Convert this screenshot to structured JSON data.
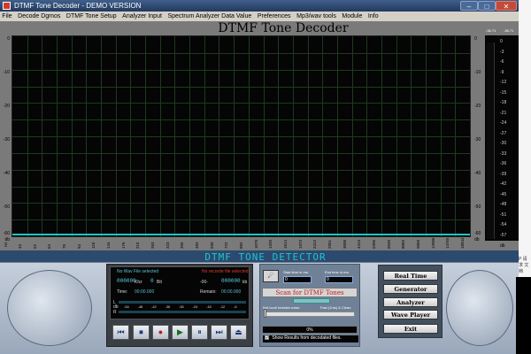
{
  "window": {
    "title": "DTMF Tone Decoder - DEMO VERSION",
    "min_glyph": "–",
    "max_glyph": "□",
    "close_glyph": "✕"
  },
  "menu": [
    "File",
    "Decode Dgmos",
    "DTMF Tone Setup",
    "Analyzer Input",
    "Spectrum Analyzer Data Value",
    "Preferences",
    "Mp3/wav tools",
    "Module",
    "Info"
  ],
  "plot": {
    "title": "DTMF Tone Decoder",
    "y_left_labels": [
      "0",
      "-10",
      "-20",
      "-30",
      "-40",
      "-50",
      "-60"
    ],
    "db_left": "db",
    "y_right_labels": [
      "0",
      "-10",
      "-20",
      "-30",
      "-40",
      "-50",
      "-60"
    ],
    "db_right": "db",
    "x_labels": [
      "43",
      "52",
      "64",
      "78",
      "94",
      "118",
      "144",
      "176",
      "215",
      "263",
      "323",
      "395",
      "483",
      "590",
      "722",
      "882",
      "1079",
      "1320",
      "1614",
      "1973",
      "2413",
      "2951",
      "3608",
      "4413",
      "5396",
      "6599",
      "8069",
      "9868",
      "12066",
      "14755",
      "18044"
    ],
    "x_hz": "Hz"
  },
  "meter": {
    "headers": [
      "-36.71",
      "-36.71"
    ],
    "labels": [
      "0",
      "-3",
      "-6",
      "-9",
      "-12",
      "-15",
      "-18",
      "-21",
      "-24",
      "-27",
      "-30",
      "-33",
      "-36",
      "-39",
      "-42",
      "-45",
      "-48",
      "-51",
      "-54",
      "-57"
    ],
    "db": "db"
  },
  "detector": {
    "label": "DTMF TONE DETECTOR"
  },
  "player": {
    "file_status": "No Wav File selected",
    "file_error": "No recorde file selected",
    "khz_value": "000000",
    "khz_unit": "Khz",
    "bit_value": "0",
    "bit_unit": "Bit",
    "kb_prefix": "-00-",
    "kb_value": "000000",
    "kb_unit": "kb",
    "time_label": "Time:",
    "time_value": "00:00.000",
    "remain_label": "Remain:",
    "remain_value": "00:00.000",
    "vu_scale": [
      "-54",
      "-48",
      "-42",
      "-36",
      "-30",
      "-24",
      "-18",
      "-12",
      "-6"
    ],
    "channel_left": "L",
    "channel_right": "R",
    "db_label": "db",
    "transport": [
      "⏮",
      "⏹",
      "●",
      "▶",
      "⏸",
      "⏭",
      "⏏"
    ]
  },
  "scan": {
    "start_label": "Start time in ms:",
    "start_value": "0",
    "end_label": "End time in ms:",
    "end_value": "0",
    "button": "Scan for DTMF Tones",
    "slider_left": "Not loud/ besides noise",
    "slider_right": "Fast (1ms) & Clean",
    "progress": "0%",
    "show_results": "Show Results from decodated files.",
    "show_checked": "✔"
  },
  "modes": [
    "Real Time",
    "Generator",
    "Analyzer",
    "Wave Player",
    "Exit"
  ],
  "side": {
    "text": "P 请求 文档"
  }
}
